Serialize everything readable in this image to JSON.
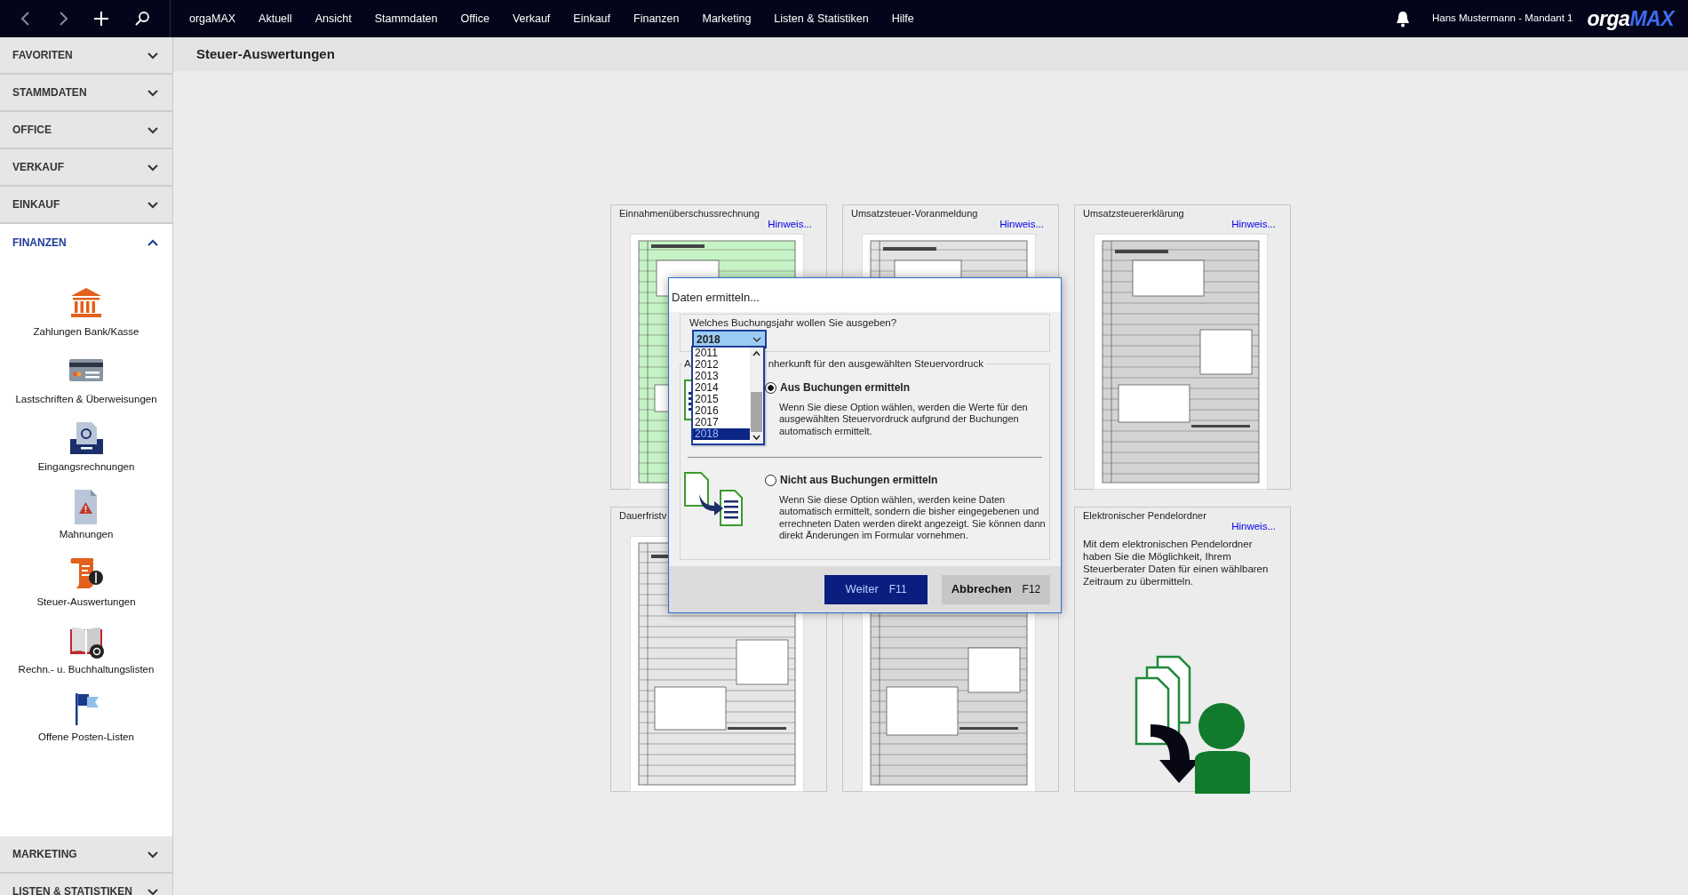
{
  "topbar": {
    "menu": [
      {
        "label": "orgaMAX"
      },
      {
        "label": "Aktuell"
      },
      {
        "label": "Ansicht"
      },
      {
        "label": "Stammdaten"
      },
      {
        "label": "Office"
      },
      {
        "label": "Verkauf"
      },
      {
        "label": "Einkauf"
      },
      {
        "label": "Finanzen"
      },
      {
        "label": "Marketing"
      },
      {
        "label": "Listen & Statistiken"
      },
      {
        "label": "Hilfe"
      }
    ],
    "user": "Hans Mustermann - Mandant 1",
    "logo": {
      "part_1": "orga",
      "part_2": "MAX"
    }
  },
  "sidebar": {
    "sections": [
      {
        "label": "FAVORITEN",
        "expanded": false
      },
      {
        "label": "STAMMDATEN",
        "expanded": false
      },
      {
        "label": "OFFICE",
        "expanded": false
      },
      {
        "label": "VERKAUF",
        "expanded": false
      },
      {
        "label": "EINKAUF",
        "expanded": false
      },
      {
        "label": "FINANZEN",
        "expanded": true,
        "items": [
          {
            "label": "Zahlungen Bank/Kasse"
          },
          {
            "label": "Lastschriften & Überweisungen"
          },
          {
            "label": "Eingangsrechnungen"
          },
          {
            "label": "Mahnungen"
          },
          {
            "label": "Steuer-Auswertungen"
          },
          {
            "label": "Rechn.- u. Buchhaltungslisten"
          },
          {
            "label": "Offene Posten-Listen"
          }
        ]
      },
      {
        "label": "MARKETING",
        "expanded": false
      },
      {
        "label": "LISTEN & STATISTIKEN",
        "expanded": false
      }
    ]
  },
  "page_title": "Steuer-Auswertungen",
  "cards": [
    {
      "kind": "form",
      "title": "Einnahmenüberschussrechnung",
      "link": "Hinweis...",
      "color": "#c6f3c6"
    },
    {
      "kind": "form",
      "title": "Umsatzsteuer-Voranmeldung",
      "link": "Hinweis...",
      "color": "#e2e2e2"
    },
    {
      "kind": "form",
      "title": "Umsatzsteuererklärung",
      "link": "Hinweis...",
      "color": "#d4d4d4"
    },
    {
      "kind": "form",
      "title": "Dauerfristv",
      "color": "#e6e6e6"
    },
    {
      "kind": "form",
      "color": "#d8d8d8"
    },
    {
      "kind": "info",
      "title": "Elektronischer Pendelordner",
      "link": "Hinweis...",
      "text": "Mit dem elektronischen Pendelordner haben Sie die Möglichkeit, Ihrem Steuerberater Daten für einen wählbaren Zeitraum zu übermitteln."
    }
  ],
  "dialog": {
    "title": "Daten ermitteln...",
    "year_group": {
      "legend": "Welches Buchungsjahr wollen Sie ausgeben?",
      "value": "2018",
      "expanded": true,
      "options": [
        {
          "label": "2011",
          "selected": false
        },
        {
          "label": "2012",
          "selected": false
        },
        {
          "label": "2013",
          "selected": false
        },
        {
          "label": "2014",
          "selected": false
        },
        {
          "label": "2015",
          "selected": false
        },
        {
          "label": "2016",
          "selected": false
        },
        {
          "label": "2017",
          "selected": false
        },
        {
          "label": "2018",
          "selected": true
        }
      ]
    },
    "source_group": {
      "legend_start": "A",
      "legend_end": "nherkunft für den ausgewählten Steuervordruck",
      "options": [
        {
          "label": "Aus Buchungen ermitteln",
          "selected": true,
          "description": "Wenn Sie diese Option wählen, werden die Werte für den ausgewählten Steuervordruck aufgrund der Buchungen automatisch ermittelt."
        },
        {
          "label": "Nicht aus Buchungen ermitteln",
          "selected": false,
          "description": "Wenn Sie diese Option wählen, werden keine Daten automatisch ermittelt, sondern die bisher eingegebenen und errechneten Daten werden direkt angezeigt. Sie können dann direkt Änderungen im Formular vornehmen."
        }
      ]
    },
    "buttons": [
      {
        "label": "Weiter",
        "key": "F11",
        "kind": "primary"
      },
      {
        "label": "Abbrechen",
        "key": "F12",
        "kind": "secondary"
      }
    ]
  }
}
